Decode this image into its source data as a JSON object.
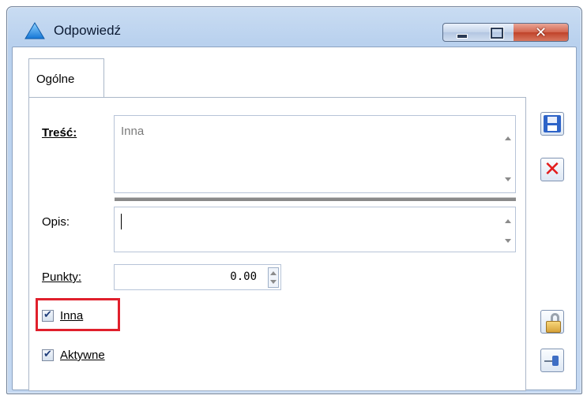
{
  "window": {
    "title": "Odpowiedź",
    "controls": {
      "minimize_icon": "minimize-icon",
      "maximize_icon": "maximize-icon",
      "close_glyph": "✕"
    }
  },
  "tabs": [
    {
      "label": "Ogólne",
      "active": true
    }
  ],
  "form": {
    "tresc": {
      "label": "Treść:",
      "value": "Inna"
    },
    "opis": {
      "label": "Opis:",
      "value": ""
    },
    "punkty": {
      "label": "Punkty:",
      "value": "0.00"
    },
    "inna": {
      "label": "Inna",
      "checked": true
    },
    "aktywne": {
      "label": "Aktywne",
      "checked": true
    }
  },
  "side_buttons": [
    {
      "name": "save",
      "icon": "save-icon"
    },
    {
      "name": "cancel",
      "icon": "close-red-icon"
    },
    {
      "name": "lock",
      "icon": "padlock-open-icon"
    },
    {
      "name": "pin",
      "icon": "pin-icon"
    }
  ],
  "colors": {
    "highlight": "#e0202c",
    "titlebar": "#b9d1ee",
    "close_button": "#c0432a"
  }
}
